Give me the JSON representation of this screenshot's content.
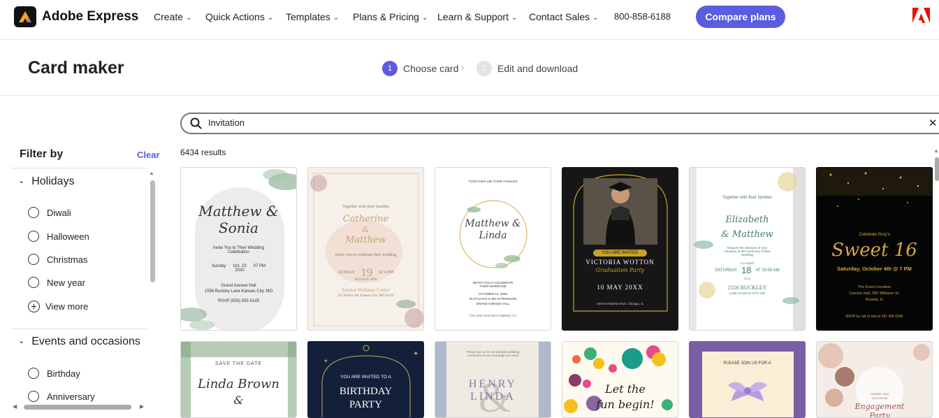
{
  "nav": {
    "brand": "Adobe Express",
    "items": [
      "Create",
      "Quick Actions",
      "Templates",
      "Plans & Pricing",
      "Learn & Support",
      "Contact Sales"
    ],
    "phone": "800-858-6188",
    "compare_label": "Compare plans"
  },
  "header": {
    "title": "Card maker",
    "step1_num": "1",
    "step1_label": "Choose card",
    "step2_num": "2",
    "step2_label": "Edit and download"
  },
  "search": {
    "value": "Invitation",
    "results": "6434 results"
  },
  "sidebar": {
    "filter_title": "Filter by",
    "clear_label": "Clear",
    "holidays": {
      "label": "Holidays",
      "options": [
        "Diwali",
        "Halloween",
        "Christmas",
        "New year"
      ],
      "view_more": "View more"
    },
    "events": {
      "label": "Events and occasions",
      "options": [
        "Birthday",
        "Anniversary"
      ]
    }
  },
  "cards": {
    "c1": {
      "names": "Matthew & Sonia",
      "invite": "Invite You to Their Wedding Celebration",
      "day": "Sunday",
      "date": "Oct. 23",
      "year": "2030",
      "time": "07 PM",
      "venue": "Grand Avenue Hall",
      "address": "1556 Buckley Lane Kansas City, MO",
      "rsvp": "RSVP (555) 555-0145"
    },
    "c2": {
      "intro": "Together with their families",
      "name1": "Catherine",
      "amp": "&",
      "name2": "Matthew",
      "invite": "invite you to celebrate their wedding",
      "day": "SUNDAY",
      "date": "19",
      "time": "AT 4 PM",
      "month": "AUGUST 2030",
      "venue": "Sunrise Wellness Center",
      "address": "123 Willow Rd, Kansas City, MO 64101"
    },
    "c3": {
      "intro": "TOGETHER with THEIR FAMILIES",
      "names": "Matthew & Linda",
      "invite": "INVITE YOU to CELEBRATE THEIR MARRIAGE",
      "date": "OCTOBER 12, 2030",
      "time": "05 O'CLOCK in the AFTERNOON",
      "venue": "GRAND AVENUE HALL",
      "address": "778 Lane View Drive Oakland, CA"
    },
    "c4": {
      "banner": "YOU ARE INVITED",
      "name": "VICTORIA WOTTON",
      "sub": "Graduation Party",
      "date": "10 MAY 20XX",
      "address": "1678 Kemberly Drive, Chicago, IL"
    },
    "c5": {
      "intro": "Together with their families",
      "name1": "Elizabeth",
      "name2": "& Matthew",
      "invite": "Request the pleasure of your company at the ceremony of their wedding",
      "month": "OCTOBER",
      "day": "SATURDAY",
      "date": "18",
      "time": "AT 10:00 AM",
      "year": "2024",
      "venue": "1556 BUCKLEY",
      "address": "LANE KANSAS CITY, MO"
    },
    "c6": {
      "intro": "Celebrate Rory's",
      "title": "Sweet 16",
      "date": "Saturday, October 4th @ 7 PM",
      "venue": "The Event Location",
      "address": "Carnick Hall, 382 Williams St.",
      "city": "Kinardy, IL",
      "rsvp": "RSVP by call or text to 331 555 0145"
    },
    "r2c1": {
      "top": "SAVE THE DATE",
      "name": "Linda Brown",
      "amp": "&"
    },
    "r2c2": {
      "invite": "YOU ARE INVITED TO A",
      "title": "BIRTHDAY",
      "title2": "PARTY"
    },
    "r2c3": {
      "intro": "Please join us for an intimate wedding ceremony as we exchange our vows",
      "name1": "HENRY",
      "name2": "LINDA"
    },
    "r2c4": {
      "text1": "Let the",
      "text2": "fun begin!"
    },
    "r2c5": {
      "text": "PLEASE JOIN US FOR A"
    },
    "r2c6": {
      "small1": "PLEASE JOIN",
      "small2": "US FOR AN",
      "script": "Engagement Party"
    }
  },
  "colors": {
    "accent": "#5c5ce0"
  }
}
